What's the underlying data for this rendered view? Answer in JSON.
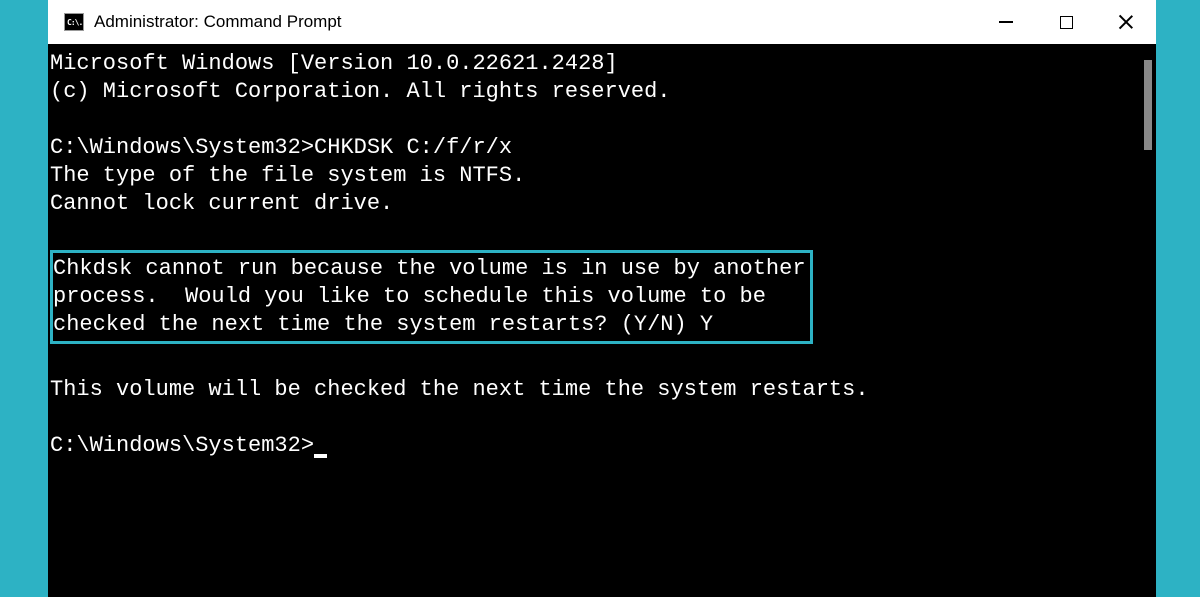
{
  "window": {
    "icon_label": "C:\\.",
    "title": "Administrator: Command Prompt"
  },
  "terminal": {
    "line1": "Microsoft Windows [Version 10.0.22621.2428]",
    "line2": "(c) Microsoft Corporation. All rights reserved.",
    "line3": "C:\\Windows\\System32>CHKDSK C:/f/r/x",
    "line4": "The type of the file system is NTFS.",
    "line5": "Cannot lock current drive.",
    "highlighted_line1": "Chkdsk cannot run because the volume is in use by another",
    "highlighted_line2": "process.  Would you like to schedule this volume to be",
    "highlighted_line3": "checked the next time the system restarts? (Y/N) Y",
    "line6": "This volume will be checked the next time the system restarts.",
    "prompt": "C:\\Windows\\System32>"
  }
}
